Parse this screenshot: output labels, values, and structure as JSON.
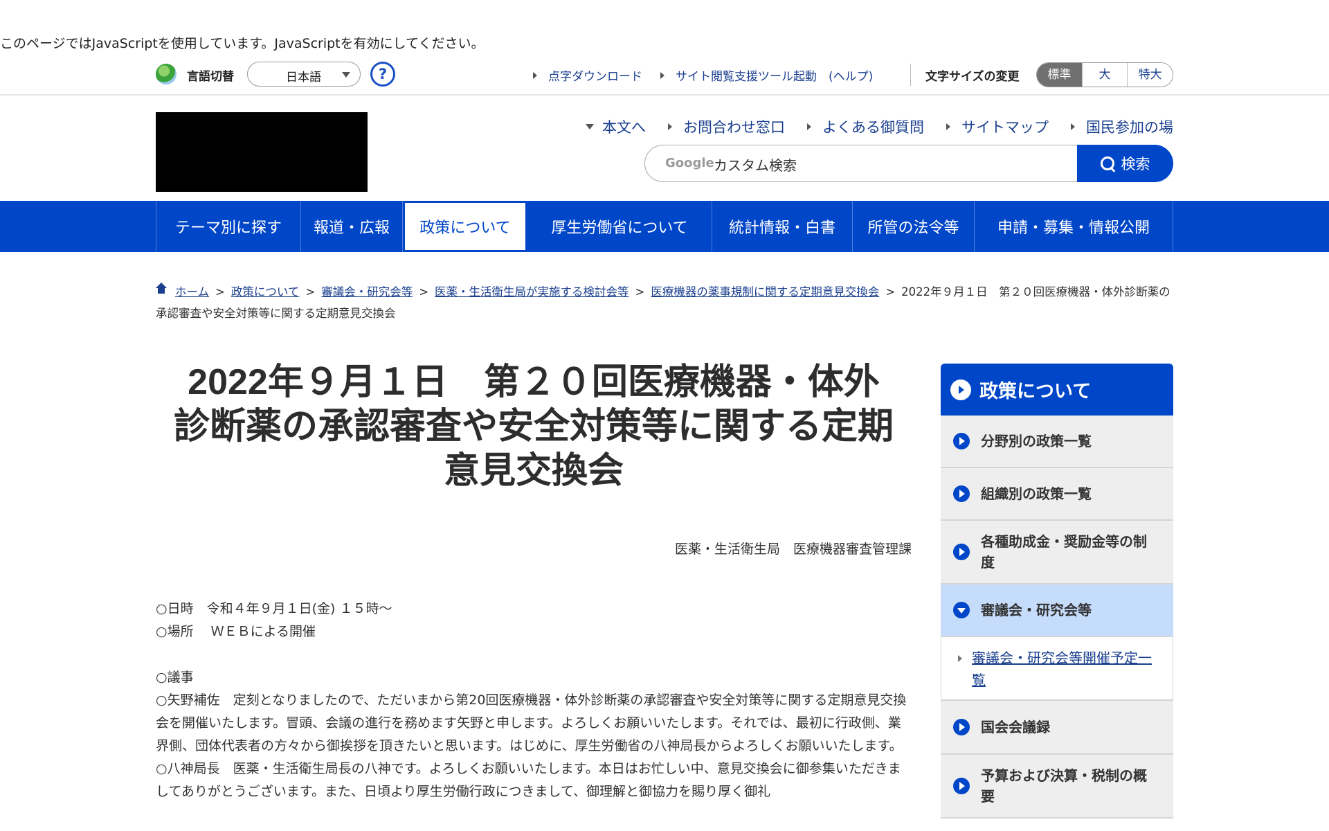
{
  "noscript_message": "このページではJavaScriptを使用しています。JavaScriptを有効にしてください。",
  "utility": {
    "lang_label": "言語切替",
    "lang_value": "日本語",
    "help_symbol": "?",
    "links": [
      "点字ダウンロード",
      "サイト閲覧支援ツール起動　(ヘルプ)"
    ],
    "font_size_label": "文字サイズの変更",
    "font_sizes": [
      "標準",
      "大",
      "特大"
    ],
    "font_size_active": "標準"
  },
  "header": {
    "links": [
      "本文へ",
      "お問合わせ窓口",
      "よくある御質問",
      "サイトマップ",
      "国民参加の場"
    ],
    "search": {
      "google_label": "Google",
      "placeholder": "カスタム検索",
      "button_label": "検索"
    }
  },
  "global_nav": {
    "items": [
      "テーマ別に探す",
      "報道・広報",
      "政策について",
      "厚生労働省について",
      "統計情報・白書",
      "所管の法令等",
      "申請・募集・情報公開"
    ],
    "active": "政策について"
  },
  "breadcrumb": {
    "links": [
      "ホーム",
      "政策について",
      "審議会・研究会等",
      "医薬・生活衛生局が実施する検討会等",
      "医療機器の薬事規制に関する定期意見交換会"
    ],
    "current": "2022年９月１日　第２０回医療機器・体外診断薬の承認審査や安全対策等に関する定期意見交換会",
    "separator": ">"
  },
  "main": {
    "title_lines": [
      "2022年９月１日　第２０回医療機器・体外",
      "診断薬の承認審査や安全対策等に関する定期",
      "意見交換会"
    ],
    "department": "医薬・生活衛生局　医療機器審査管理課",
    "date_line": "○日時　令和４年９月１日(金) １５時～",
    "place_line": "○場所　 ＷＥＢによる開催",
    "agenda_heading": "○議事",
    "paragraphs": [
      "○矢野補佐　定刻となりましたので、ただいまから第20回医療機器・体外診断薬の承認審査や安全対策等に関する定期意見交換会を開催いたします。冒頭、会議の進行を務めます矢野と申します。よろしくお願いいたします。それでは、最初に行政側、業界側、団体代表者の方々から御挨拶を頂きたいと思います。はじめに、厚生労働省の八神局長からよろしくお願いいたします。",
      "○八神局長　医薬・生活衛生局長の八神です。よろしくお願いいたします。本日はお忙しい中、意見交換会に御参集いただきましてありがとうございます。また、日頃より厚生労働行政につきまして、御理解と御協力を賜り厚く御礼"
    ]
  },
  "side_nav": {
    "heading": "政策について",
    "items": [
      {
        "label": "分野別の政策一覧",
        "open": false
      },
      {
        "label": "組織別の政策一覧",
        "open": false
      },
      {
        "label": "各種助成金・奨励金等の制度",
        "open": false
      },
      {
        "label": "審議会・研究会等",
        "open": true
      }
    ],
    "sub_item": "審議会・研究会等開催予定一覧",
    "items_after": [
      {
        "label": "国会会議録"
      },
      {
        "label": "予算および決算・税制の概要"
      }
    ]
  },
  "colors": {
    "brand_blue": "#0046c8",
    "link": "#1a3f8f",
    "side_open_bg": "#c6dcfb",
    "side_item_bg": "#eeeeee"
  }
}
